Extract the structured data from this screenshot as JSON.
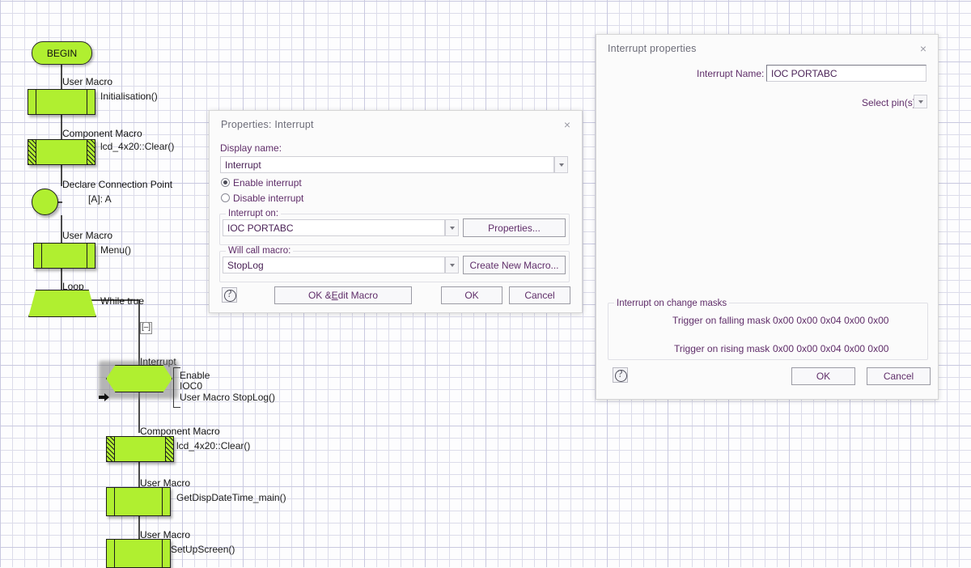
{
  "canvas": {
    "begin": {
      "label": "BEGIN"
    },
    "nodes": [
      {
        "type": "user-macro",
        "title": "User Macro",
        "detail": "Initialisation()"
      },
      {
        "type": "component-macro",
        "title": "Component Macro",
        "detail": "lcd_4x20::Clear()"
      },
      {
        "type": "connection-point",
        "title": "Declare Connection Point",
        "detail": "[A]: A"
      },
      {
        "type": "user-macro",
        "title": "User Macro",
        "detail": "Menu()"
      },
      {
        "type": "loop",
        "title": "Loop",
        "detail": "While true"
      },
      {
        "type": "interrupt",
        "title": "Interrupt",
        "detail_1": "Enable",
        "detail_2": "IOC0",
        "detail_3": "User Macro StopLog()"
      },
      {
        "type": "component-macro",
        "title": "Component Macro",
        "detail": "lcd_4x20::Clear()"
      },
      {
        "type": "user-macro",
        "title": "User Macro",
        "detail": "GetDispDateTime_main()"
      },
      {
        "type": "user-macro",
        "title": "User Macro",
        "detail": "SetUpScreen()"
      }
    ],
    "collapse_marker": "[–]"
  },
  "properties_dialog": {
    "title": "Properties: Interrupt",
    "close_icon": "×",
    "display_name_label": "Display name:",
    "display_name_value": "Interrupt",
    "radio_enable_label": "Enable interrupt",
    "radio_disable_label": "Disable interrupt",
    "radio_selected": "enable",
    "interrupt_on_group": "Interrupt on:",
    "interrupt_on_value": "IOC PORTABC",
    "properties_button": "Properties...",
    "will_call_macro_group": "Will call macro:",
    "will_call_macro_value": "StopLog",
    "create_macro_button": "Create New Macro...",
    "help_icon": "help-icon",
    "ok_edit_macro_button_pre": "OK & ",
    "ok_edit_macro_button_mnemonic": "E",
    "ok_edit_macro_button_post": "dit Macro",
    "ok_button": "OK",
    "cancel_button": "Cancel"
  },
  "interrupt_dialog": {
    "title": "Interrupt properties",
    "close_icon": "×",
    "interrupt_name_label": "Interrupt Name:",
    "interrupt_name_value": "IOC PORTABC",
    "select_pins_label": "Select pin(s)",
    "masks_group": "Interrupt on change masks",
    "falling_label": "Trigger on falling mask",
    "falling_value": "0x00 0x00 0x04 0x00 0x00",
    "rising_label": "Trigger on rising mask",
    "rising_value": "0x00 0x00 0x04 0x00 0x00",
    "help_icon": "help-icon",
    "ok_button": "OK",
    "cancel_button": "Cancel"
  },
  "colors": {
    "shape_fill": "#b0ef30",
    "shape_stroke": "#1d1d1d",
    "dialog_text": "#5f2d69",
    "grid_line": "#dcdcea"
  }
}
